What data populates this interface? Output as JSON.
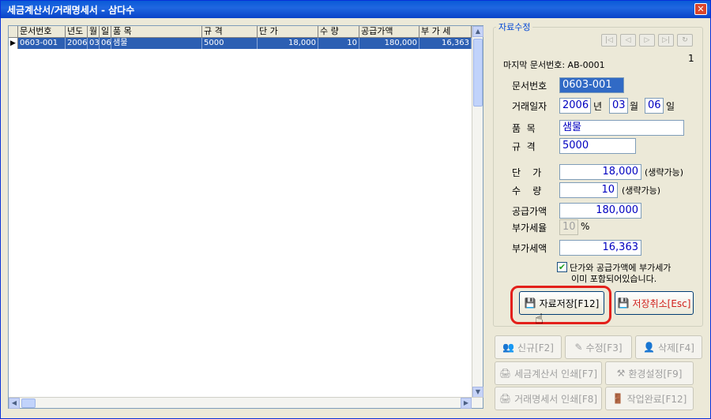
{
  "window": {
    "title": "세금계산서/거래명세서 - 삼다수",
    "close_glyph": "✕"
  },
  "grid": {
    "columns": [
      "문서번호",
      "년도",
      "월",
      "일",
      "품 목",
      "규 격",
      "단 가",
      "수 량",
      "공급가액",
      "부 가 세"
    ],
    "row": {
      "indicator": "▶",
      "cells": [
        "0603-001",
        "2006",
        "03",
        "06",
        "샘물",
        "5000",
        "18,000",
        "10",
        "180,000",
        "16,363"
      ]
    }
  },
  "panel": {
    "title": "자료수정",
    "nav": [
      "|◁",
      "◁",
      "▷",
      "▷|",
      "↻"
    ],
    "counter": "1",
    "last_doc_label": "마지막 문서번호: AB-0001",
    "doc_no_label": "문서번호",
    "doc_no": "0603-001",
    "date_label": "거래일자",
    "year": "2006",
    "year_unit": "년",
    "month": "03",
    "month_unit": "월",
    "day": "06",
    "day_unit": "일",
    "item_label": "품  목",
    "item": "샘물",
    "spec_label": "규  격",
    "spec": "5000",
    "price_label": "단    가",
    "price": "18,000",
    "price_note": "(생략가능)",
    "qty_label": "수    량",
    "qty": "10",
    "qty_note": "(생략가능)",
    "supply_label": "공급가액",
    "supply": "180,000",
    "vat_rate_label": "부가세율",
    "vat_rate": "10",
    "vat_rate_unit": "%",
    "vat_label": "부가세액",
    "vat": "16,363",
    "checkbox_line1": "단가와 공급가액에 부가세가",
    "checkbox_line2": "이미 포함되어있습니다.",
    "checkbox_checked": "✔"
  },
  "buttons": {
    "save": "자료저장[F12]",
    "cancel": "저장취소[Esc]",
    "new": "신규[F2]",
    "edit": "수정[F3]",
    "delete": "삭제[F4]",
    "print_tax": "세금계산서 인쇄[F7]",
    "settings": "환경설정[F9]",
    "print_stmt": "거래명세서 인쇄[F8]",
    "finish": "작업완료[F12]"
  },
  "colors": {
    "accent_red": "#e3201b",
    "selection": "#2c5fb3"
  }
}
